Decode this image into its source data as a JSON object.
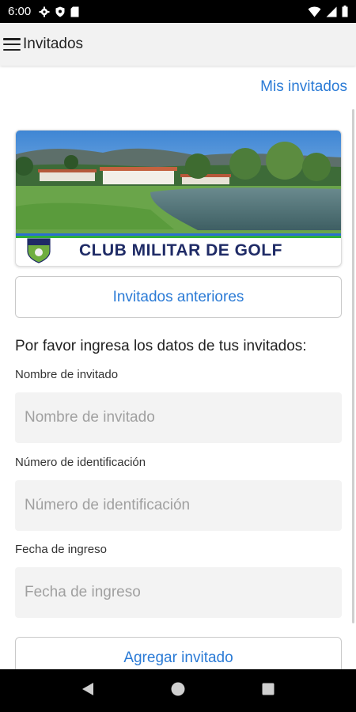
{
  "status_bar": {
    "time": "6:00",
    "left_icons": [
      "gear-icon",
      "shield-icon",
      "sd-card-icon"
    ],
    "right_icons": [
      "wifi-icon",
      "signal-icon",
      "battery-icon"
    ]
  },
  "app_bar": {
    "title": "Invitados",
    "menu_icon": "menu-icon"
  },
  "top_link": "Mis invitados",
  "banner": {
    "club_name": "CLUB MILITAR DE GOLF"
  },
  "buttons": {
    "previous_guests": "Invitados anteriores",
    "add_guest": "Agregar invitado"
  },
  "form": {
    "instructions": "Por favor ingresa los datos de tus invitados:",
    "fields": [
      {
        "label": "Nombre de invitado",
        "value": "",
        "placeholder": "Nombre de invitado"
      },
      {
        "label": "Número de identificación",
        "value": "",
        "placeholder": "Número de identificación"
      },
      {
        "label": "Fecha de ingreso",
        "value": "",
        "placeholder": "Fecha de ingreso"
      }
    ]
  },
  "nav_bar": [
    "back-icon",
    "home-icon",
    "recents-icon"
  ],
  "colors": {
    "accent": "#2b7bd6",
    "club_navy": "#1f2b66",
    "input_bg": "#f3f3f3"
  }
}
